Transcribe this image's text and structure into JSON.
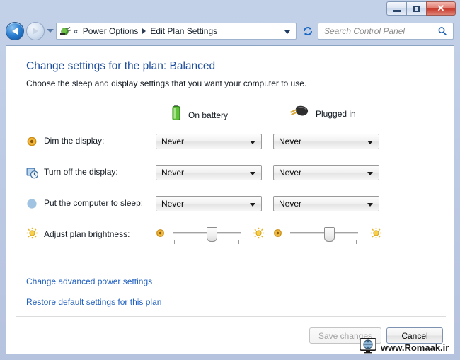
{
  "window": {
    "controls": {
      "minimize": "Minimize",
      "maximize": "Maximize",
      "close": "✕"
    }
  },
  "navbar": {
    "back_label": "Back",
    "forward_label": "Forward",
    "history_label": "Recent pages",
    "chevrons": "«",
    "breadcrumb": [
      {
        "label": "Power Options"
      },
      {
        "label": "Edit Plan Settings"
      }
    ],
    "refresh_label": "Refresh",
    "search": {
      "placeholder": "Search Control Panel",
      "value": ""
    }
  },
  "main": {
    "title": "Change settings for the plan: Balanced",
    "subtitle": "Choose the sleep and display settings that you want your computer to use.",
    "columns": [
      {
        "label": "On battery",
        "icon": "battery-icon"
      },
      {
        "label": "Plugged in",
        "icon": "power-plug-icon"
      }
    ],
    "rows": [
      {
        "icon": "dim-display-icon",
        "label": "Dim the display:",
        "on_battery": "Never",
        "plugged_in": "Never"
      },
      {
        "icon": "turn-off-display-icon",
        "label": "Turn off the display:",
        "on_battery": "Never",
        "plugged_in": "Never"
      },
      {
        "icon": "sleep-icon",
        "label": "Put the computer to sleep:",
        "on_battery": "Never",
        "plugged_in": "Never"
      }
    ],
    "brightness": {
      "icon": "brightness-icon",
      "label": "Adjust plan brightness:",
      "on_battery_value": 55,
      "plugged_in_value": 55,
      "min_icon": "dim-sun-icon",
      "max_icon": "bright-sun-icon"
    },
    "links": [
      {
        "label": "Change advanced power settings"
      },
      {
        "label": "Restore default settings for this plan"
      }
    ],
    "buttons": {
      "save": "Save changes",
      "cancel": "Cancel"
    }
  },
  "watermark": {
    "text": "www.Romaak.ir"
  },
  "colors": {
    "accent_link": "#1f5fbf",
    "title_blue": "#1f4f9c",
    "battery_green": "#4caf2a",
    "glass": "#bcc9e3",
    "close_red": "#c7392b"
  }
}
